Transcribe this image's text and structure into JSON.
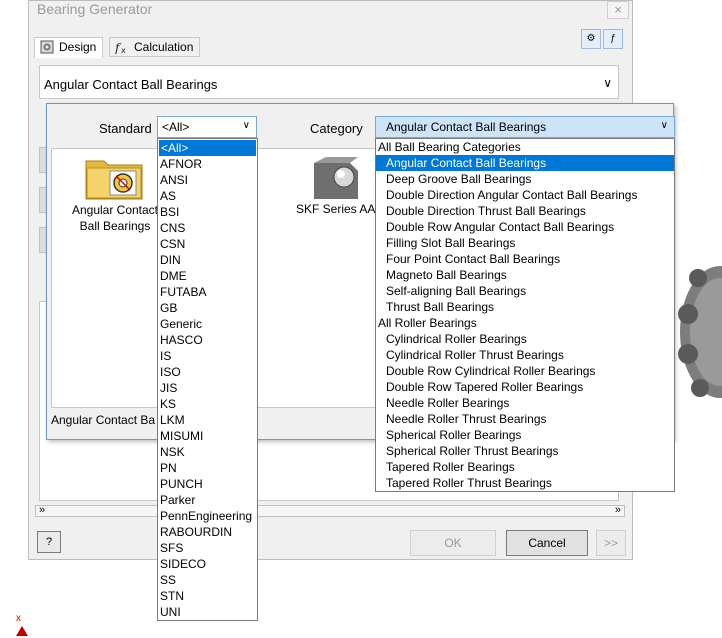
{
  "window": {
    "title": "Bearing Generator",
    "close_glyph": "×",
    "tabs": [
      {
        "label": "Design",
        "icon": "design-icon"
      },
      {
        "label": "Calculation",
        "icon": "fx-icon"
      }
    ],
    "main_category": "Angular Contact Ball Bearings",
    "buttons": {
      "ok": "OK",
      "cancel": "Cancel",
      "more": ">>",
      "help": "?"
    }
  },
  "selector": {
    "standard_label": "Standard",
    "standard_value": "<All>",
    "category_label": "Category",
    "category_value": "Angular Contact Ball Bearings",
    "items": [
      {
        "label_line1": "Angular Contact",
        "label_line2": "Ball Bearings",
        "icon": "folder-icon"
      },
      {
        "label": "SKF Series AA",
        "icon": "skf-bearing-icon"
      }
    ],
    "status_text": "Angular Contact Ba"
  },
  "standard_options": [
    "<All>",
    "AFNOR",
    "ANSI",
    "AS",
    "BSI",
    "CNS",
    "CSN",
    "DIN",
    "DME",
    "FUTABA",
    "GB",
    "Generic",
    "HASCO",
    "IS",
    "ISO",
    "JIS",
    "KS",
    "LKM",
    "MISUMI",
    "NSK",
    "PN",
    "PUNCH",
    "Parker",
    "PennEngineering",
    "RABOURDIN",
    "SFS",
    "SIDECO",
    "SS",
    "STN",
    "UNI"
  ],
  "category_options": [
    {
      "label": "All Ball Bearing Categories",
      "group": true
    },
    {
      "label": "Angular Contact Ball Bearings",
      "selected": true
    },
    {
      "label": "Deep Groove Ball Bearings"
    },
    {
      "label": "Double Direction Angular Contact Ball Bearings"
    },
    {
      "label": "Double Direction Thrust Ball Bearings"
    },
    {
      "label": "Double Row Angular Contact Ball Bearings"
    },
    {
      "label": "Filling Slot Ball Bearings"
    },
    {
      "label": "Four Point Contact Ball Bearings"
    },
    {
      "label": "Magneto Ball Bearings"
    },
    {
      "label": "Self-aligning Ball Bearings"
    },
    {
      "label": "Thrust Ball Bearings"
    },
    {
      "label": "All Roller Bearings",
      "group": true
    },
    {
      "label": "Cylindrical Roller Bearings"
    },
    {
      "label": "Cylindrical Roller Thrust Bearings"
    },
    {
      "label": "Double Row Cylindrical Roller Bearings"
    },
    {
      "label": "Double Row Tapered Roller Bearings"
    },
    {
      "label": "Needle Roller Bearings"
    },
    {
      "label": "Needle Roller Thrust Bearings"
    },
    {
      "label": "Spherical Roller Bearings"
    },
    {
      "label": "Spherical Roller Thrust Bearings"
    },
    {
      "label": "Tapered Roller Bearings"
    },
    {
      "label": "Tapered Roller Thrust Bearings"
    }
  ],
  "viewport": {
    "axis_label": "x"
  },
  "colors": {
    "selection": "#0078d7",
    "combo_focus": "#cde3f7",
    "axis": "#c00000"
  }
}
